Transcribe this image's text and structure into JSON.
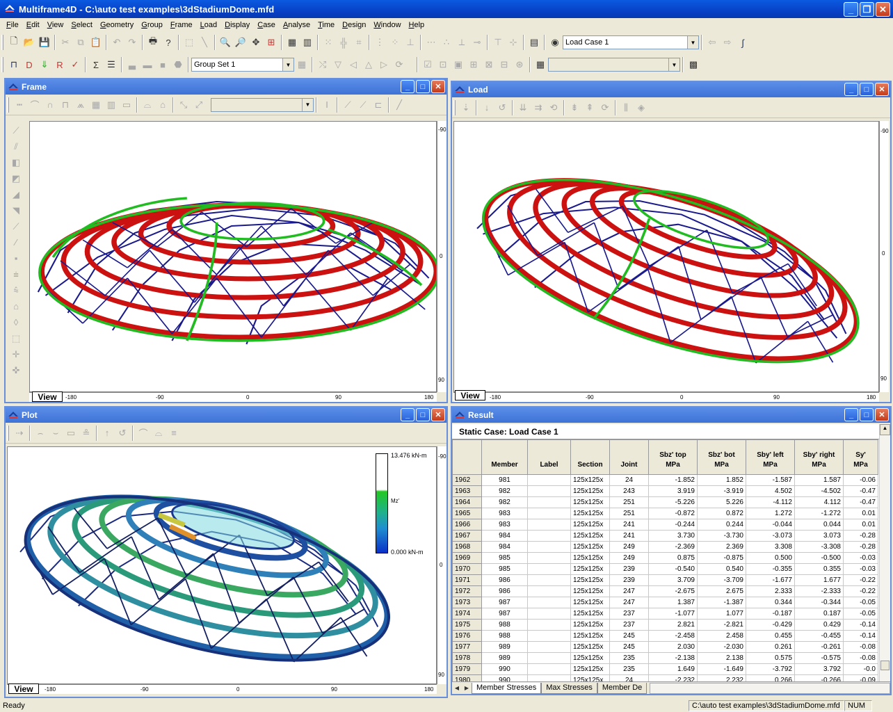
{
  "app": {
    "title": "Multiframe4D - C:\\auto test examples\\3dStadiumDome.mfd"
  },
  "menu": [
    "File",
    "Edit",
    "View",
    "Select",
    "Geometry",
    "Group",
    "Frame",
    "Load",
    "Display",
    "Case",
    "Analyse",
    "Time",
    "Design",
    "Window",
    "Help"
  ],
  "toolbar": {
    "load_case": "Load Case 1",
    "group_set": "Group Set 1"
  },
  "frame_window": {
    "title": "Frame",
    "view_tab": "View",
    "h_ticks": [
      "-180",
      "-90",
      "0",
      "90",
      "180"
    ],
    "v_ticks": [
      "-90",
      "0",
      "90"
    ]
  },
  "load_window": {
    "title": "Load",
    "view_tab": "View",
    "h_ticks": [
      "-180",
      "-90",
      "0",
      "90",
      "180"
    ],
    "v_ticks": [
      "-90",
      "0",
      "90"
    ]
  },
  "plot_window": {
    "title": "Plot",
    "view_tab": "View",
    "h_ticks": [
      "-180",
      "-90",
      "0",
      "90",
      "180"
    ],
    "v_ticks": [
      "-90",
      "0",
      "90"
    ],
    "legend": {
      "max": "13.476 kN-m",
      "min": "0.000 kN-m",
      "label": "Mz'"
    }
  },
  "result_window": {
    "title": "Result",
    "case_header": "Static Case: Load Case 1",
    "columns": [
      "",
      "Member",
      "Label",
      "Section",
      "Joint",
      "Sbz' top\nMPa",
      "Sbz' bot\nMPa",
      "Sby' left\nMPa",
      "Sby' right\nMPa",
      "Sy'\nMPa"
    ],
    "rows": [
      [
        "1962",
        "981",
        "",
        "125x125x",
        "24",
        "-1.852",
        "1.852",
        "-1.587",
        "1.587",
        "-0.06"
      ],
      [
        "1963",
        "982",
        "",
        "125x125x",
        "243",
        "3.919",
        "-3.919",
        "4.502",
        "-4.502",
        "-0.47"
      ],
      [
        "1964",
        "982",
        "",
        "125x125x",
        "251",
        "-5.226",
        "5.226",
        "-4.112",
        "4.112",
        "-0.47"
      ],
      [
        "1965",
        "983",
        "",
        "125x125x",
        "251",
        "-0.872",
        "0.872",
        "1.272",
        "-1.272",
        "0.01"
      ],
      [
        "1966",
        "983",
        "",
        "125x125x",
        "241",
        "-0.244",
        "0.244",
        "-0.044",
        "0.044",
        "0.01"
      ],
      [
        "1967",
        "984",
        "",
        "125x125x",
        "241",
        "3.730",
        "-3.730",
        "-3.073",
        "3.073",
        "-0.28"
      ],
      [
        "1968",
        "984",
        "",
        "125x125x",
        "249",
        "-2.369",
        "2.369",
        "3.308",
        "-3.308",
        "-0.28"
      ],
      [
        "1969",
        "985",
        "",
        "125x125x",
        "249",
        "0.875",
        "-0.875",
        "0.500",
        "-0.500",
        "-0.03"
      ],
      [
        "1970",
        "985",
        "",
        "125x125x",
        "239",
        "-0.540",
        "0.540",
        "-0.355",
        "0.355",
        "-0.03"
      ],
      [
        "1971",
        "986",
        "",
        "125x125x",
        "239",
        "3.709",
        "-3.709",
        "-1.677",
        "1.677",
        "-0.22"
      ],
      [
        "1972",
        "986",
        "",
        "125x125x",
        "247",
        "-2.675",
        "2.675",
        "2.333",
        "-2.333",
        "-0.22"
      ],
      [
        "1973",
        "987",
        "",
        "125x125x",
        "247",
        "1.387",
        "-1.387",
        "0.344",
        "-0.344",
        "-0.05"
      ],
      [
        "1974",
        "987",
        "",
        "125x125x",
        "237",
        "-1.077",
        "1.077",
        "-0.187",
        "0.187",
        "-0.05"
      ],
      [
        "1975",
        "988",
        "",
        "125x125x",
        "237",
        "2.821",
        "-2.821",
        "-0.429",
        "0.429",
        "-0.14"
      ],
      [
        "1976",
        "988",
        "",
        "125x125x",
        "245",
        "-2.458",
        "2.458",
        "0.455",
        "-0.455",
        "-0.14"
      ],
      [
        "1977",
        "989",
        "",
        "125x125x",
        "245",
        "2.030",
        "-2.030",
        "0.261",
        "-0.261",
        "-0.08"
      ],
      [
        "1978",
        "989",
        "",
        "125x125x",
        "235",
        "-2.138",
        "2.138",
        "0.575",
        "-0.575",
        "-0.08"
      ],
      [
        "1979",
        "990",
        "",
        "125x125x",
        "235",
        "1.649",
        "-1.649",
        "-3.792",
        "3.792",
        "-0.0"
      ],
      [
        "1980",
        "990",
        "",
        "125x125x",
        "24",
        "-2.232",
        "2.232",
        "0.266",
        "-0.266",
        "-0.09"
      ]
    ],
    "sheet_tabs": [
      "Member Stresses",
      "Max Stresses",
      "Member De"
    ]
  },
  "status": {
    "ready": "Ready",
    "path": "C:\\auto test examples\\3dStadiumDome.mfd",
    "num": "NUM"
  },
  "colors": {
    "member_red": "#cc1111",
    "member_blue": "#1a1a8c",
    "member_green": "#22bb22",
    "title_blue": "#0842c8"
  }
}
